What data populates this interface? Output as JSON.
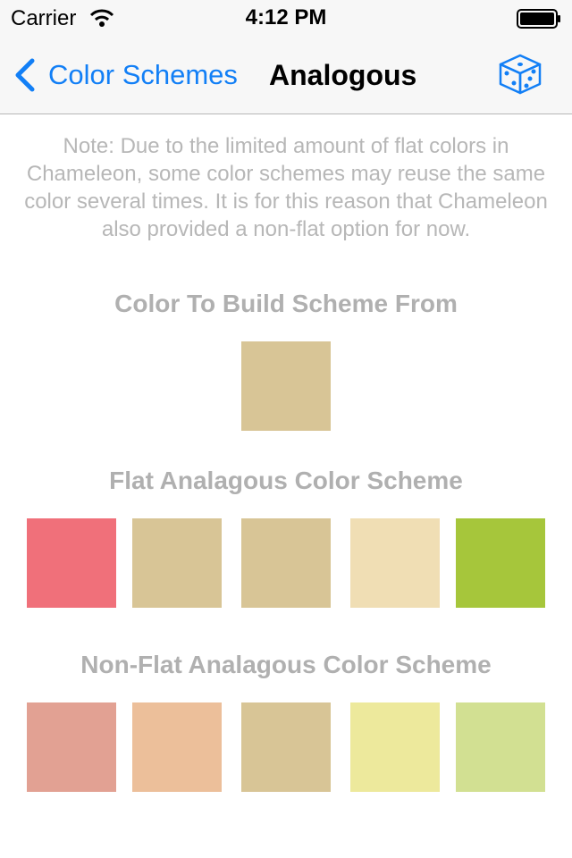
{
  "status_bar": {
    "carrier": "Carrier",
    "time": "4:12 PM",
    "wifi_icon": "wifi-icon",
    "battery_icon": "battery-icon"
  },
  "nav_bar": {
    "back_label": "Color Schemes",
    "back_icon": "chevron-left-icon",
    "title": "Analogous",
    "action_icon": "dice-icon",
    "accent_color": "#127ff6"
  },
  "note": "Note: Due to the limited amount of flat colors in Chameleon, some color schemes may reuse the same color several times. It is for this reason that Chameleon also provided a non-flat option for now.",
  "base_section": {
    "title": "Color To Build Scheme From",
    "color": "#d8c596"
  },
  "flat_section": {
    "title": "Flat Analagous Color Scheme",
    "colors": [
      "#f0707a",
      "#d8c596",
      "#d8c596",
      "#f0deb4",
      "#a6c63b"
    ]
  },
  "nonflat_section": {
    "title": "Non-Flat Analagous Color Scheme",
    "colors": [
      "#e2a193",
      "#ecbf9a",
      "#d8c596",
      "#ede99c",
      "#d2e092"
    ]
  }
}
